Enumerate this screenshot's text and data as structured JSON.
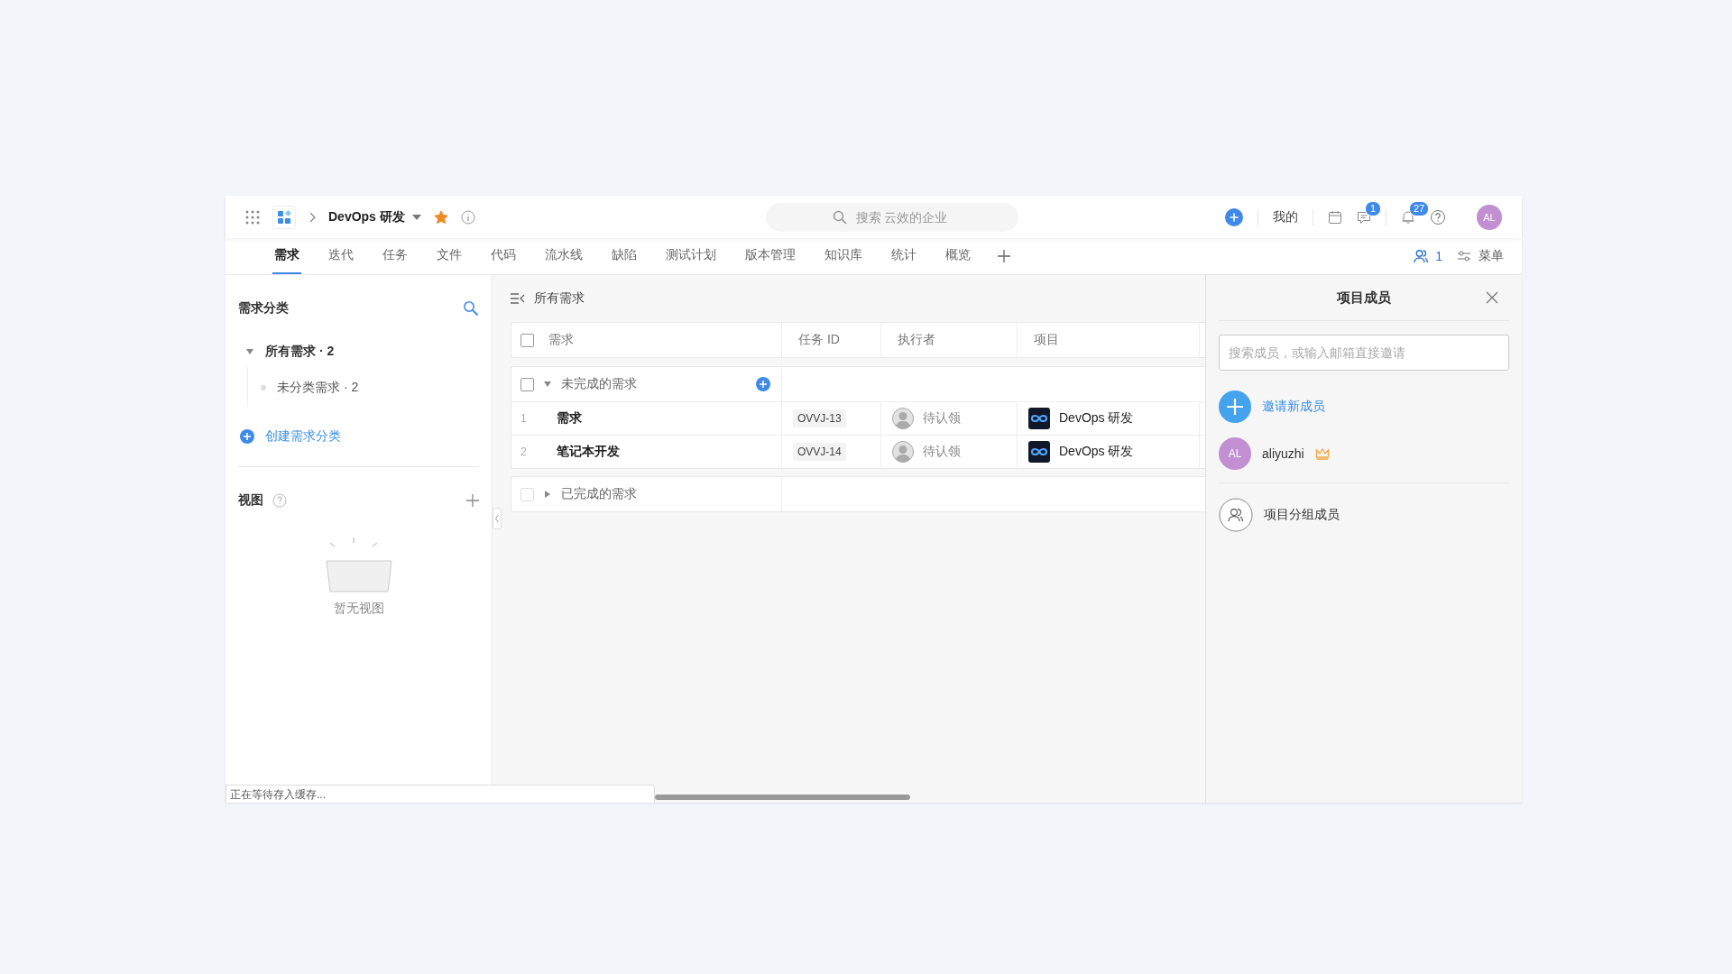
{
  "topbar": {
    "project": "DevOps 研发",
    "starred": true,
    "search": {
      "placeholder": "搜索 云效的企业"
    },
    "mine": "我的",
    "message_badge": "1",
    "notice_badge": "27",
    "avatar": "AL"
  },
  "tabs": [
    {
      "label": "需求",
      "selected": true
    },
    {
      "label": "迭代",
      "selected": false
    },
    {
      "label": "任务",
      "selected": false
    },
    {
      "label": "文件",
      "selected": false
    },
    {
      "label": "代码",
      "selected": false
    },
    {
      "label": "流水线",
      "selected": false
    },
    {
      "label": "缺陷",
      "selected": false
    },
    {
      "label": "测试计划",
      "selected": false
    },
    {
      "label": "版本管理",
      "selected": false
    },
    {
      "label": "知识库",
      "selected": false
    },
    {
      "label": "统计",
      "selected": false
    },
    {
      "label": "概览",
      "selected": false
    }
  ],
  "tab_tools": {
    "member_count": "1",
    "menu": "菜单"
  },
  "sidebar": {
    "title": "需求分类",
    "tree": [
      {
        "label": "所有需求 · 2",
        "expanded": true,
        "children": [
          {
            "label": "未分类需求 · 2"
          }
        ]
      }
    ],
    "create": "创建需求分类",
    "views_title": "视图",
    "views_empty": "暂无视图"
  },
  "main": {
    "title": "所有需求",
    "select_all_checked": false,
    "columns": [
      "需求",
      "任务 ID",
      "执行者",
      "项目"
    ],
    "groups": [
      {
        "label": "未完成的需求",
        "expanded": true,
        "disabled": false,
        "checked": false,
        "rows": [
          {
            "index": "1",
            "title": "需求",
            "id": "OVVJ-13",
            "assignee": "待认领",
            "project": "DevOps 研发"
          },
          {
            "index": "2",
            "title": "笔记本开发",
            "id": "OVVJ-14",
            "assignee": "待认领",
            "project": "DevOps 研发"
          }
        ]
      },
      {
        "label": "已完成的需求",
        "expanded": false,
        "disabled": true,
        "checked": false
      }
    ]
  },
  "panel": {
    "title": "项目成员",
    "search": {
      "placeholder": "搜索成员，或输入邮箱直接邀请"
    },
    "invite": "邀请新成员",
    "members": [
      {
        "initials": "AL",
        "name": "aliyuzhi",
        "owner": true
      }
    ],
    "groups": "项目分组成员"
  },
  "status_bar": "正在等待存入缓存..."
}
